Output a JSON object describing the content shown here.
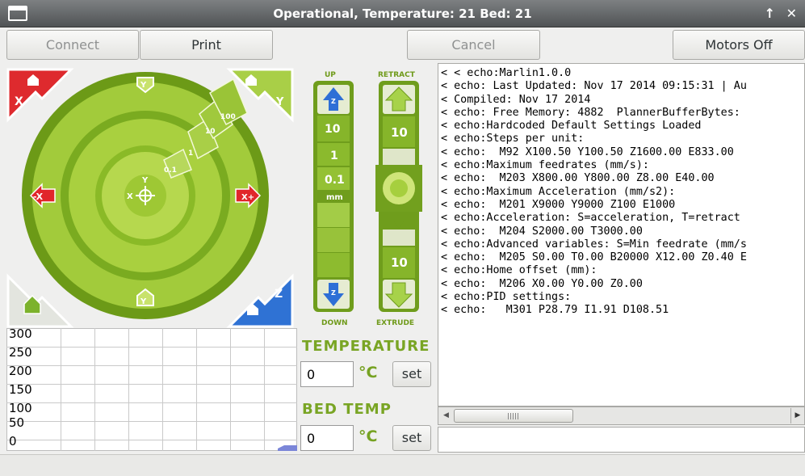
{
  "window": {
    "title": "Operational, Temperature: 21 Bed: 21",
    "controls": [
      "↑",
      "✕"
    ]
  },
  "toolbar": {
    "connect_label": "Connect",
    "print_label": "Print",
    "cancel_label": "Cancel",
    "motors_off_label": "Motors Off"
  },
  "xy_control": {
    "home_x": "X",
    "home_y": "Y",
    "home_z": "Z",
    "minus_x": "-X",
    "plus_x": "X+",
    "step_labels": [
      "0.1",
      "1",
      "10",
      "100"
    ],
    "center_y_top": "Y",
    "center_x_left": "X",
    "center_y_bottom": "Y"
  },
  "z_control": {
    "up_label": "UP",
    "down_label": "DOWN",
    "steps": [
      "10",
      "1",
      "0.1"
    ],
    "unit": "mm",
    "z_up_icon": "Z",
    "z_down_icon": "Z"
  },
  "extruder_control": {
    "retract_label": "RETRACT",
    "extrude_label": "EXTRUDE",
    "top_amount": "10",
    "bottom_amount": "10"
  },
  "temp_graph": {
    "y_ticks": [
      "300",
      "250",
      "200",
      "150",
      "100",
      "50",
      "0"
    ]
  },
  "temperature": {
    "label": "TEMPERATURE",
    "value": "0",
    "unit": "°C",
    "set_label": "set"
  },
  "bed_temp": {
    "label": "BED TEMP",
    "value": "0",
    "unit": "°C",
    "set_label": "set"
  },
  "log_lines": [
    "< < echo:Marlin1.0.0",
    "< echo: Last Updated: Nov 17 2014 09:15:31 | Au",
    "< Compiled: Nov 17 2014",
    "< echo: Free Memory: 4882  PlannerBufferBytes: ",
    "< echo:Hardcoded Default Settings Loaded",
    "< echo:Steps per unit:",
    "< echo:  M92 X100.50 Y100.50 Z1600.00 E833.00",
    "< echo:Maximum feedrates (mm/s):",
    "< echo:  M203 X800.00 Y800.00 Z8.00 E40.00",
    "< echo:Maximum Acceleration (mm/s2):",
    "< echo:  M201 X9000 Y9000 Z100 E1000",
    "< echo:Acceleration: S=acceleration, T=retract",
    "< echo:  M204 S2000.00 T3000.00",
    "< echo:Advanced variables: S=Min feedrate (mm/s",
    "< echo:  M205 S0.00 T0.00 B20000 X12.00 Z0.40 E",
    "< echo:Home offset (mm):",
    "< echo:  M206 X0.00 Y0.00 Z0.00",
    "< echo:PID settings:",
    "< echo:   M301 P28.79 I1.91 D108.51"
  ],
  "colors": {
    "green_dark": "#5e8a13",
    "green_mid": "#8bbb24",
    "green_light": "#b9d95a",
    "home_x_red": "#d9262b",
    "home_z_blue": "#2f6fce",
    "arrow_red": "#d9262b",
    "z_blue": "#2e6fd6"
  }
}
